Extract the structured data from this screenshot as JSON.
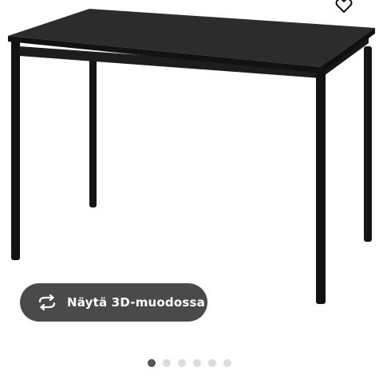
{
  "product": {
    "image_alt": "Black rectangular table with four thin metal legs",
    "favorite_icon": "heart-icon"
  },
  "view_3d": {
    "icon": "rotate-3d-icon",
    "label": "Näytä 3D-muodossa"
  },
  "pager": {
    "total": 6,
    "active": 0
  }
}
